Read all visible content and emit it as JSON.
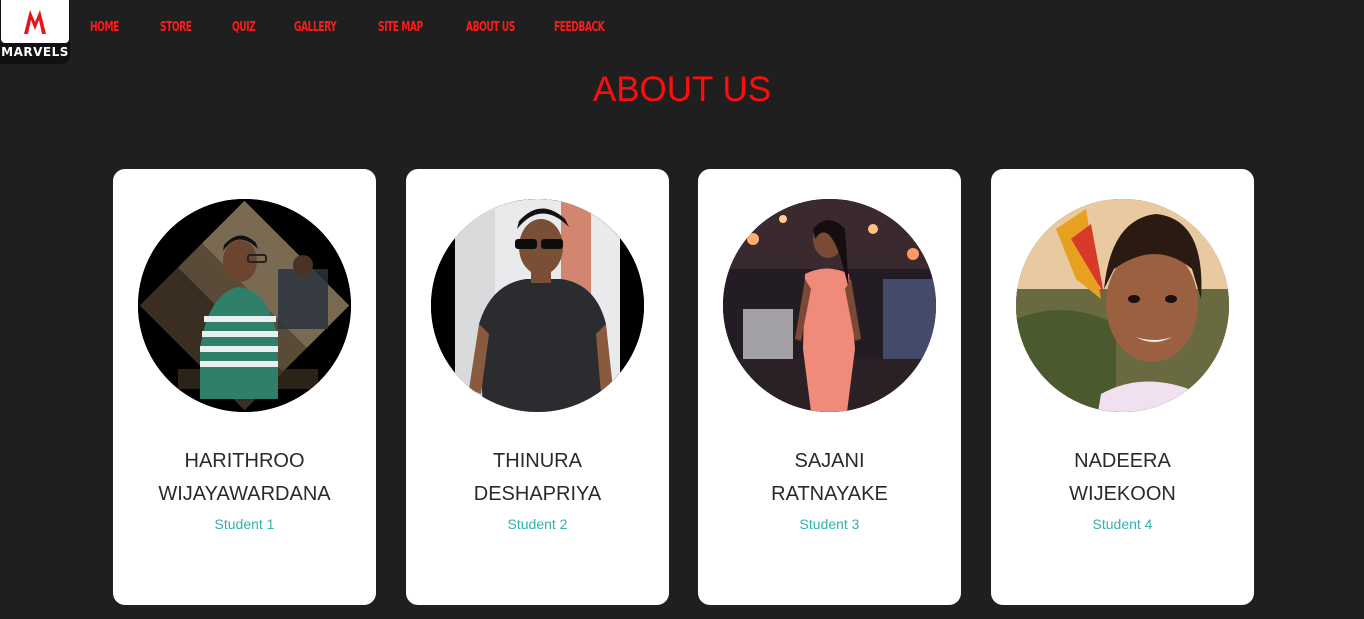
{
  "logo": {
    "text": "MARVELS",
    "accent": "#e8141c"
  },
  "nav": {
    "items": [
      {
        "label": "HOME"
      },
      {
        "label": "STORE"
      },
      {
        "label": "QUIZ"
      },
      {
        "label": "GALLERY"
      },
      {
        "label": "SITE MAP"
      },
      {
        "label": "ABOUT US"
      },
      {
        "label": "FEEDBACK"
      }
    ]
  },
  "page": {
    "title": "ABOUT US",
    "background": "#1f1f1f",
    "title_color": "#ff0d0d"
  },
  "team": [
    {
      "first_line": "HARITHROO",
      "second_line": "WIJAYAWARDANA",
      "role": "Student 1",
      "photo": "photo-harithroo"
    },
    {
      "first_line": "THINURA",
      "second_line": "DESHAPRIYA",
      "role": "Student 2",
      "photo": "photo-thinura"
    },
    {
      "first_line": "SAJANI",
      "second_line": "RATNAYAKE",
      "role": "Student 3",
      "photo": "photo-sajani"
    },
    {
      "first_line": "NADEERA",
      "second_line": "WIJEKOON",
      "role": "Student 4",
      "photo": "photo-nadeera"
    }
  ],
  "colors": {
    "card": "#ffffff",
    "name": "#2a2a2a",
    "role": "#33b1ad",
    "nav": "#ff1a1a"
  }
}
